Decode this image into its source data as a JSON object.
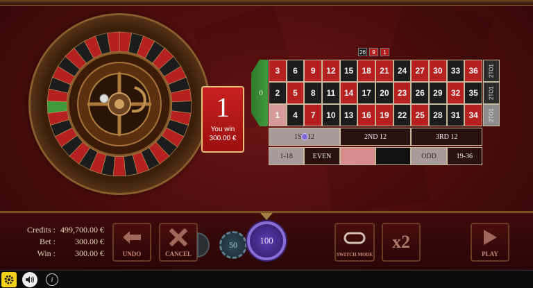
{
  "result": {
    "number": "1",
    "message_line1": "You win",
    "message_line2": "300.00 €"
  },
  "history": [
    {
      "number": "26",
      "color": "black"
    },
    {
      "number": "9",
      "color": "red"
    },
    {
      "number": "1",
      "color": "red"
    }
  ],
  "table": {
    "zero": "0",
    "rows": [
      [
        {
          "n": "3",
          "c": "red"
        },
        {
          "n": "6",
          "c": "black"
        },
        {
          "n": "9",
          "c": "red"
        },
        {
          "n": "12",
          "c": "red"
        },
        {
          "n": "15",
          "c": "black"
        },
        {
          "n": "18",
          "c": "red"
        },
        {
          "n": "21",
          "c": "red"
        },
        {
          "n": "24",
          "c": "black"
        },
        {
          "n": "27",
          "c": "red"
        },
        {
          "n": "30",
          "c": "red"
        },
        {
          "n": "33",
          "c": "black"
        },
        {
          "n": "36",
          "c": "red"
        }
      ],
      [
        {
          "n": "2",
          "c": "black"
        },
        {
          "n": "5",
          "c": "red"
        },
        {
          "n": "8",
          "c": "black"
        },
        {
          "n": "11",
          "c": "black"
        },
        {
          "n": "14",
          "c": "red"
        },
        {
          "n": "17",
          "c": "black"
        },
        {
          "n": "20",
          "c": "black"
        },
        {
          "n": "23",
          "c": "red"
        },
        {
          "n": "26",
          "c": "black"
        },
        {
          "n": "29",
          "c": "black"
        },
        {
          "n": "32",
          "c": "red"
        },
        {
          "n": "35",
          "c": "black"
        }
      ],
      [
        {
          "n": "1",
          "c": "win"
        },
        {
          "n": "4",
          "c": "black"
        },
        {
          "n": "7",
          "c": "red"
        },
        {
          "n": "10",
          "c": "black"
        },
        {
          "n": "13",
          "c": "black"
        },
        {
          "n": "16",
          "c": "red"
        },
        {
          "n": "19",
          "c": "red"
        },
        {
          "n": "22",
          "c": "black"
        },
        {
          "n": "25",
          "c": "red"
        },
        {
          "n": "28",
          "c": "black"
        },
        {
          "n": "31",
          "c": "black"
        },
        {
          "n": "34",
          "c": "red"
        }
      ]
    ],
    "columns": [
      "2TO1",
      "2TO1",
      "2TO1"
    ],
    "dozens": [
      "1ST 12",
      "2ND 12",
      "3RD 12"
    ],
    "outside": [
      "1-18",
      "EVEN",
      "",
      "",
      "ODD",
      "19-36"
    ]
  },
  "stats": {
    "credits_label": "Credits :",
    "credits_value": "499,700.00 €",
    "bet_label": "Bet :",
    "bet_value": "300.00 €",
    "win_label": "Win :",
    "win_value": "300.00 €"
  },
  "buttons": {
    "undo": "UNDO",
    "cancel": "CANCEL",
    "switch_mode": "SWITCH MODE",
    "double": "x2",
    "play": "PLAY"
  },
  "chips": {
    "small": "50",
    "selected": "100"
  },
  "info_label": "i",
  "colors": {
    "red": "#b52020",
    "black": "#1c1c1c",
    "green": "#3f9a3a",
    "gold": "#e6c27a"
  }
}
